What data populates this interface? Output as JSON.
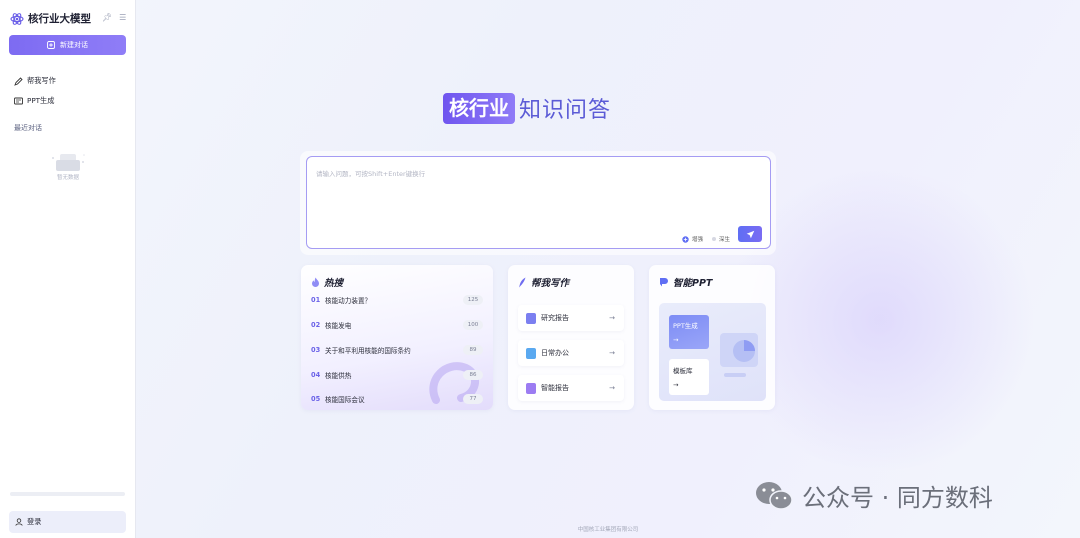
{
  "app": {
    "title": "核行业大模型",
    "new_chat": "新建对话"
  },
  "sidebar": {
    "items": [
      {
        "label": "帮我写作",
        "icon": "pen-icon"
      },
      {
        "label": "PPT生成",
        "icon": "presentation-icon"
      }
    ],
    "recent_label": "最近对话",
    "empty_text": "暂无数据",
    "login": "登录"
  },
  "headline": {
    "badge": "核行业",
    "text": "知识问答"
  },
  "input": {
    "placeholder": "请输入问题，可按Shift+Enter键换行",
    "option1": "增强",
    "option2": "深生"
  },
  "hot": {
    "title": "热搜",
    "items": [
      {
        "rank": "01",
        "text": "核能动力装置？",
        "count": "125"
      },
      {
        "rank": "02",
        "text": "核能发电",
        "count": "100"
      },
      {
        "rank": "03",
        "text": "关于和平利用核能的国际条约",
        "count": "89"
      },
      {
        "rank": "04",
        "text": "核能供热",
        "count": "86"
      },
      {
        "rank": "05",
        "text": "核能国际会议",
        "count": "77"
      }
    ]
  },
  "write": {
    "title": "帮我写作",
    "items": [
      {
        "label": "研究报告",
        "color": "#7b7ff0"
      },
      {
        "label": "日常办公",
        "color": "#5aa9f0"
      },
      {
        "label": "智能报告",
        "color": "#9c7cf2"
      }
    ]
  },
  "ppt": {
    "title": "智能PPT",
    "gen": "PPT生成",
    "lib": "模板库"
  },
  "watermark": "公众号 · 同方数科",
  "footer": "中国核工业集团有限公司",
  "colors": {
    "accent": "#7d6bf2",
    "accent_text": "#5b5bd6"
  }
}
